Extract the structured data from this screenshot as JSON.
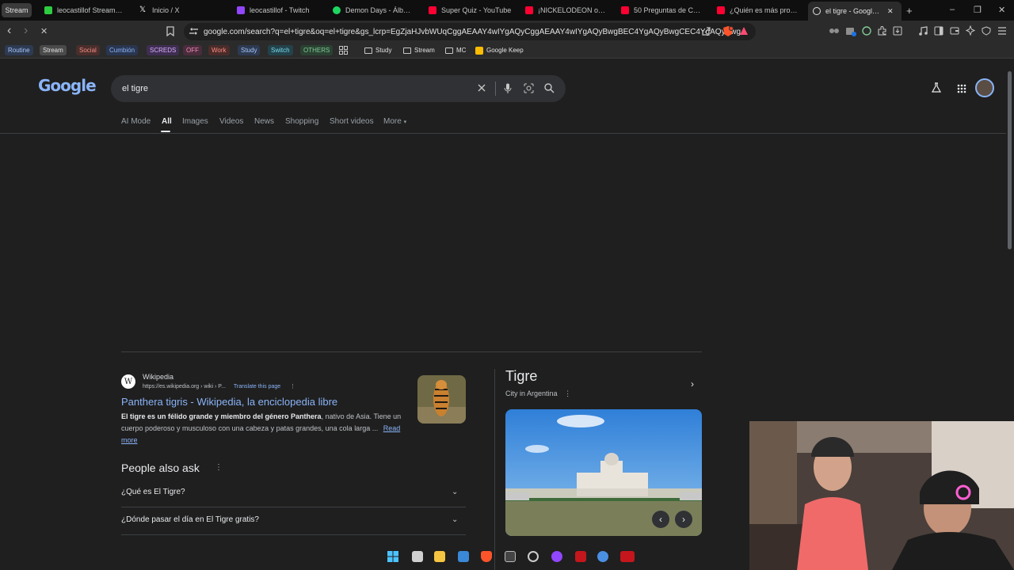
{
  "tabs": {
    "group_label": "Stream",
    "items": [
      {
        "label": "leocastillof Stream - \\",
        "color": "#2ecc40"
      },
      {
        "label": "Inicio / X",
        "color": "#ffffff"
      },
      {
        "label": "leocastillof - Twitch",
        "color": "#9146ff"
      },
      {
        "label": "Demon Days - Álbum de",
        "color": "#1ed760"
      },
      {
        "label": "Super Quiz - YouTube",
        "color": "#ff0033"
      },
      {
        "label": "¡NICKELODEON o DISNE",
        "color": "#ff0033"
      },
      {
        "label": "50 Preguntas de Cultura",
        "color": "#ff0033"
      },
      {
        "label": "¿Quién es más probable",
        "color": "#ff0033"
      },
      {
        "label": "el tigre - Google Sea",
        "color": "#e3e3e3"
      }
    ],
    "close_glyph": "✕",
    "new_tab_glyph": "+"
  },
  "window_controls": {
    "minimize": "–",
    "restore": "❐",
    "close": "✕"
  },
  "toolbar": {
    "url": "google.com/search?q=el+tigre&oq=el+tigre&gs_lcrp=EgZjaHJvbWUqCggAEAAY4wIYgAQyCggAEAAY4wIYgAQyBwgBEC4YgAQyBwgCEC4YgAQyBwg...",
    "back": "‹",
    "forward": "›",
    "stop": "✕"
  },
  "bookmarks": {
    "groups": [
      {
        "label": "Routine",
        "color": "#a8c7fa",
        "bg": "#2d3a52"
      },
      {
        "label": "Stream",
        "color": "#e3e3e3",
        "bg": "#4a4a4a"
      },
      {
        "label": "Social",
        "color": "#f28b82",
        "bg": "#4a2e2c"
      },
      {
        "label": "Cumbión",
        "color": "#8ab4f8",
        "bg": "#2a3650"
      },
      {
        "label": "SCREDS",
        "color": "#d7aefb",
        "bg": "#3f2e52"
      },
      {
        "label": "OFF",
        "color": "#f28bb8",
        "bg": "#4a2c3c"
      },
      {
        "label": "Work",
        "color": "#ff8a80",
        "bg": "#4a2c2a"
      },
      {
        "label": "Study",
        "color": "#a8c7fa",
        "bg": "#2d3a52"
      },
      {
        "label": "Switch",
        "color": "#78d9ec",
        "bg": "#23424a"
      },
      {
        "label": "OTHERS",
        "color": "#81c995",
        "bg": "#2a4232"
      }
    ],
    "folders": [
      "Study",
      "Stream",
      "MC"
    ],
    "keep": "Google Keep"
  },
  "google": {
    "logo": "Google",
    "query": "el tigre",
    "tabs": [
      "AI Mode",
      "All",
      "Images",
      "Videos",
      "News",
      "Shopping",
      "Short videos",
      "More"
    ],
    "result": {
      "site": "Wikipedia",
      "url": "https://es.wikipedia.org › wiki › P...",
      "translate": "Translate this page",
      "title": "Panthera tigris - Wikipedia, la enciclopedia libre",
      "snippet_bold": "El tigre es un félido grande y miembro del género Panthera",
      "snippet_rest": ", nativo de Asia. Tiene un cuerpo poderoso y musculoso con una cabeza y patas grandes, una cola larga ...",
      "read_more": "Read more"
    },
    "paa": {
      "title": "People also ask",
      "questions": [
        "¿Qué es El Tigre?",
        "¿Dónde pasar el día en El Tigre gratis?"
      ]
    },
    "knowledge_panel": {
      "title": "Tigre",
      "subtitle": "City in Argentina"
    }
  }
}
